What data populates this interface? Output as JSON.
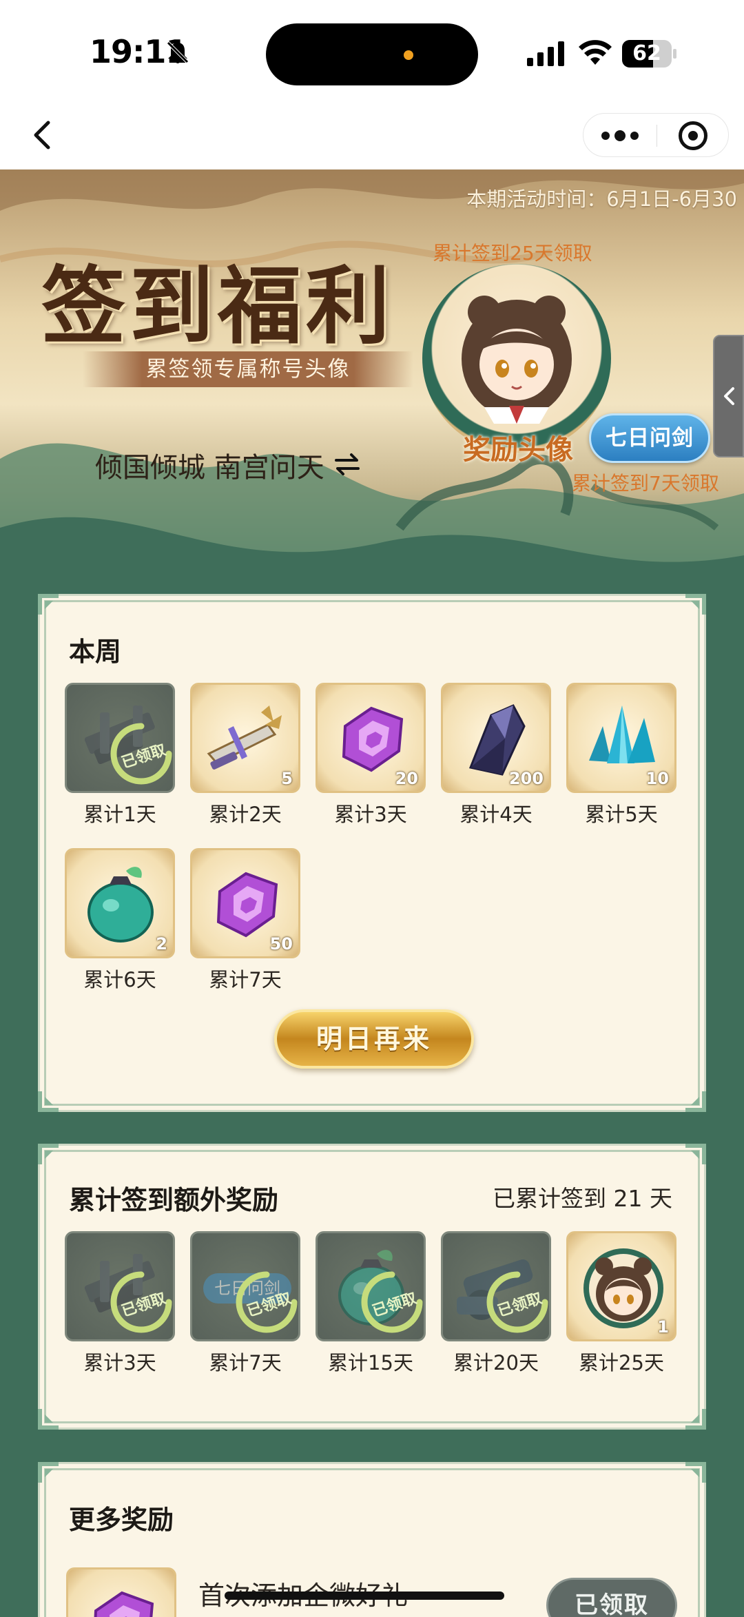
{
  "status_bar": {
    "time": "19:11",
    "battery_percent": "62",
    "battery_level": 0.62
  },
  "nav_bar": {
    "back_icon": "chevron-left-icon",
    "more_icon": "more-dots-icon",
    "close_icon": "target-circle-icon"
  },
  "banner": {
    "period": "本期活动时间：6月1日-6月30",
    "title": "签到福利",
    "subtitle": "累签领专属称号头像",
    "player_name": "倾国倾城 南宫问天",
    "avatar_hint": "累计签到25天领取",
    "avatar_caption": "奖励头像",
    "title_badge": "七日问剑",
    "badge_hint": "累计签到7天领取"
  },
  "weekly": {
    "title": "本周",
    "items": [
      {
        "label": "累计1天",
        "count": "",
        "claimed": true,
        "icon": "sword-icon"
      },
      {
        "label": "累计2天",
        "count": "5",
        "claimed": false,
        "icon": "golden-sword-icon"
      },
      {
        "label": "累计3天",
        "count": "20",
        "claimed": false,
        "icon": "purple-gem-icon"
      },
      {
        "label": "累计4天",
        "count": "200",
        "claimed": false,
        "icon": "dark-crystal-icon"
      },
      {
        "label": "累计5天",
        "count": "10",
        "claimed": false,
        "icon": "blue-crystal-icon"
      },
      {
        "label": "累计6天",
        "count": "2",
        "claimed": false,
        "icon": "green-bag-icon"
      },
      {
        "label": "累计7天",
        "count": "50",
        "claimed": false,
        "icon": "purple-gem-icon"
      }
    ],
    "button": "明日再来",
    "claimed_stamp": "已领取"
  },
  "extra": {
    "title": "累计签到额外奖励",
    "summary": "已累计签到 21 天",
    "items": [
      {
        "label": "累计3天",
        "count": "",
        "claimed": true,
        "icon": "sword-icon"
      },
      {
        "label": "累计7天",
        "count": "",
        "claimed": true,
        "icon": "title-badge-icon",
        "badge_text": "七日问剑"
      },
      {
        "label": "累计15天",
        "count": "",
        "claimed": true,
        "icon": "green-bag-icon"
      },
      {
        "label": "累计20天",
        "count": "",
        "claimed": true,
        "icon": "cannon-icon"
      },
      {
        "label": "累计25天",
        "count": "1",
        "claimed": false,
        "icon": "avatar-icon"
      }
    ]
  },
  "more": {
    "title": "更多奖励",
    "item_label": "首次添加企微好礼",
    "item_button": "已领取"
  },
  "colors": {
    "page_bg": "#3f6e5a",
    "card_bg": "#fbf5e6",
    "accent_orange": "#d9772c",
    "badge_blue": "#2c7fc1",
    "gold": "#c4861e"
  }
}
